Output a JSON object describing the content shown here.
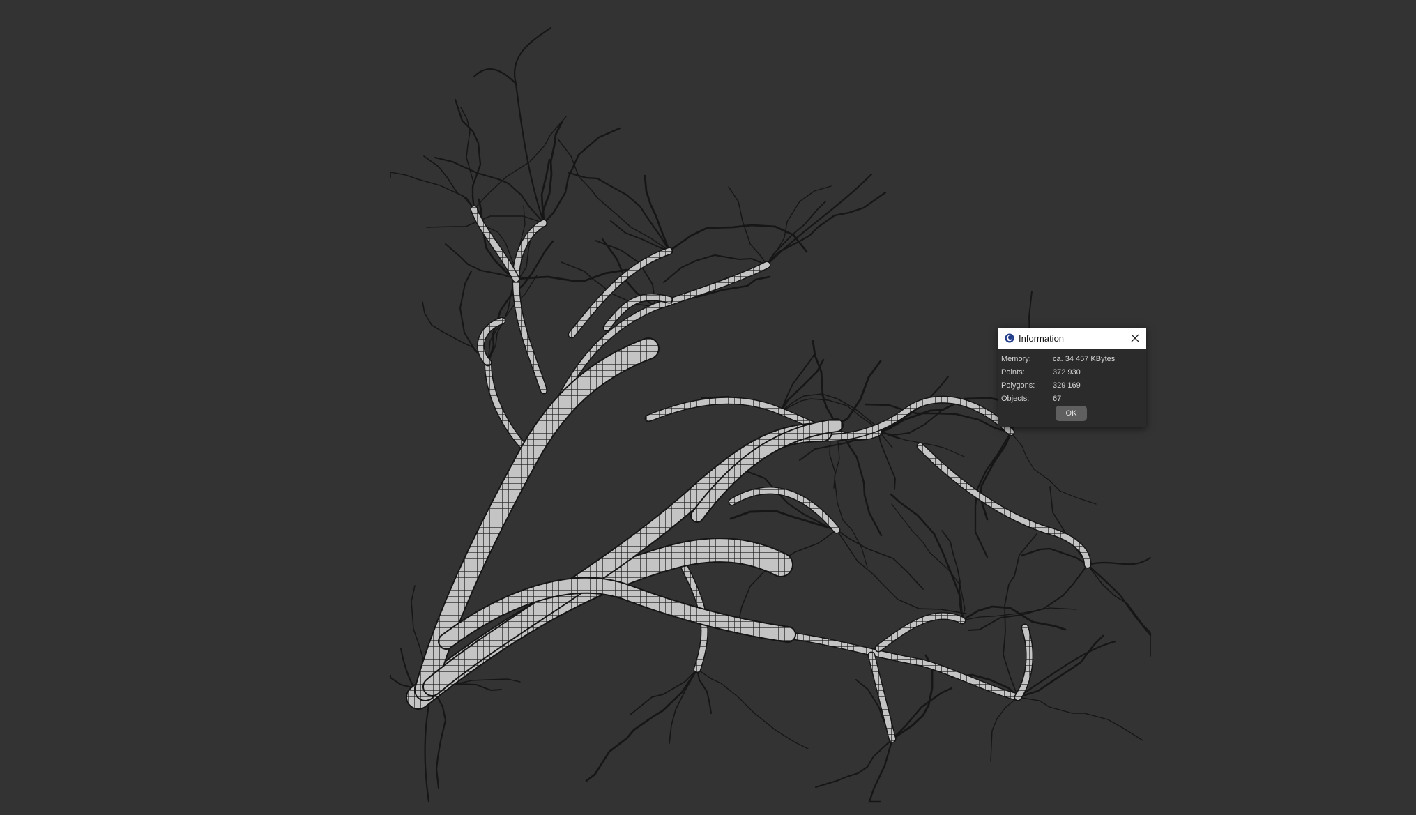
{
  "viewport": {
    "background_color": "#333333",
    "mesh_color": "#c8c8c8",
    "wire_color": "#1a1a1a"
  },
  "dialog": {
    "title": "Information",
    "app_icon": "cinema4d-icon",
    "close_icon": "close-icon",
    "rows": [
      {
        "label": "Memory:",
        "value": "ca. 34 457 KBytes"
      },
      {
        "label": "Points:",
        "value": "372 930"
      },
      {
        "label": "Polygons:",
        "value": "329 169"
      },
      {
        "label": "Objects:",
        "value": "67"
      }
    ],
    "ok_label": "OK"
  }
}
